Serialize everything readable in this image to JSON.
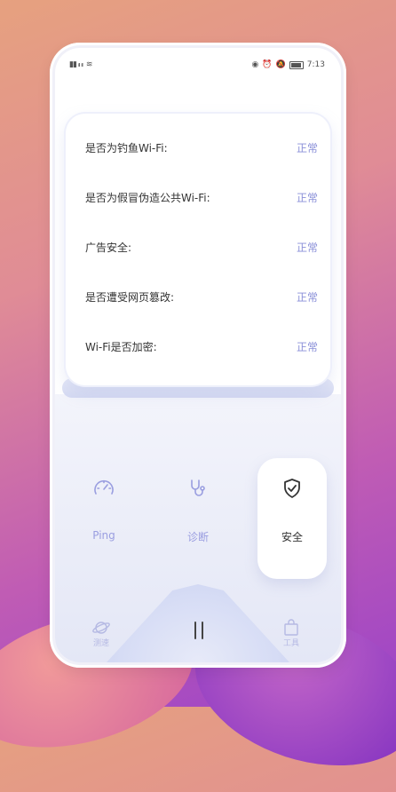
{
  "status_bar": {
    "carrier_left": "46 \"\"\"\" 46 \"\"\"\"",
    "time": "7:13"
  },
  "checks": [
    {
      "label": "是否为钓鱼Wi-Fi:",
      "status": "正常"
    },
    {
      "label": "是否为假冒伪造公共Wi-Fi:",
      "status": "正常"
    },
    {
      "label": "广告安全:",
      "status": "正常"
    },
    {
      "label": "是否遭受网页篡改:",
      "status": "正常"
    },
    {
      "label": "Wi-Fi是否加密:",
      "status": "正常"
    }
  ],
  "tools": [
    {
      "label": "Ping",
      "icon": "speedometer-icon"
    },
    {
      "label": "诊断",
      "icon": "stethoscope-icon"
    },
    {
      "label": "安全",
      "icon": "shield-check-icon",
      "active": true
    }
  ],
  "tabs": [
    {
      "label": "测速",
      "icon": "planet-icon"
    },
    {
      "label": "",
      "icon": "pause-icon"
    },
    {
      "label": "工具",
      "icon": "bag-icon"
    }
  ],
  "colors": {
    "accent": "#8a8fd8",
    "status_ok": "#8a8fd8",
    "background_start": "#e6a17f",
    "background_end": "#9b43c8"
  }
}
